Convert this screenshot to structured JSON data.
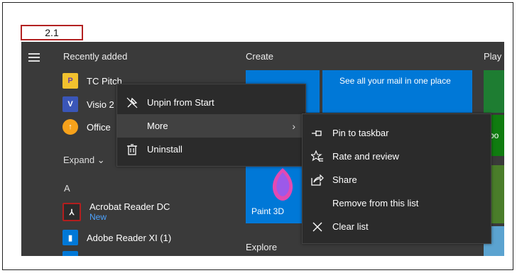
{
  "step_label": "2.1",
  "left_column": {
    "section_title": "Recently added",
    "apps": [
      {
        "label": "TC Pitch",
        "icon": "tc-pitch-icon",
        "color": "#f2c12e"
      },
      {
        "label": "Visio 2",
        "icon": "visio-icon",
        "color": "#3a56b8"
      },
      {
        "label": "Office",
        "icon": "office-icon",
        "color": "#f7a21b"
      }
    ],
    "expand_label": "Expand ⌄",
    "letter": "A",
    "a_apps": [
      {
        "label": "Acrobat Reader DC",
        "sub": "New",
        "icon": "acrobat-icon",
        "color": "#b31e1e"
      },
      {
        "label": "Adobe Reader XI (1)",
        "icon": "document-icon",
        "color": "#0078d7"
      }
    ]
  },
  "create": {
    "title": "Create",
    "mail_tile_text": "See all your mail in one place",
    "paint3d_label": "Paint 3D"
  },
  "explore": {
    "title": "Explore"
  },
  "play": {
    "title": "Play",
    "xbox_partial": "Xbo"
  },
  "context_menu": {
    "items": [
      {
        "label": "Unpin from Start",
        "icon": "unpin-icon"
      },
      {
        "label": "More",
        "icon": "",
        "has_submenu": true,
        "arrow": "›"
      },
      {
        "label": "Uninstall",
        "icon": "trash-icon"
      }
    ]
  },
  "submenu": {
    "items": [
      {
        "label": "Pin to taskbar",
        "icon": "pin-icon"
      },
      {
        "label": "Rate and review",
        "icon": "rate-review-icon"
      },
      {
        "label": "Share",
        "icon": "share-icon"
      },
      {
        "label": "Remove from this list",
        "icon": ""
      },
      {
        "label": "Clear list",
        "icon": "close-icon"
      }
    ]
  },
  "colors": {
    "start_bg": "#3a3a3a",
    "menu_bg": "#2b2b2b",
    "tile_blue": "#0078d7",
    "highlight": "#414141",
    "step_border": "#b32222"
  }
}
